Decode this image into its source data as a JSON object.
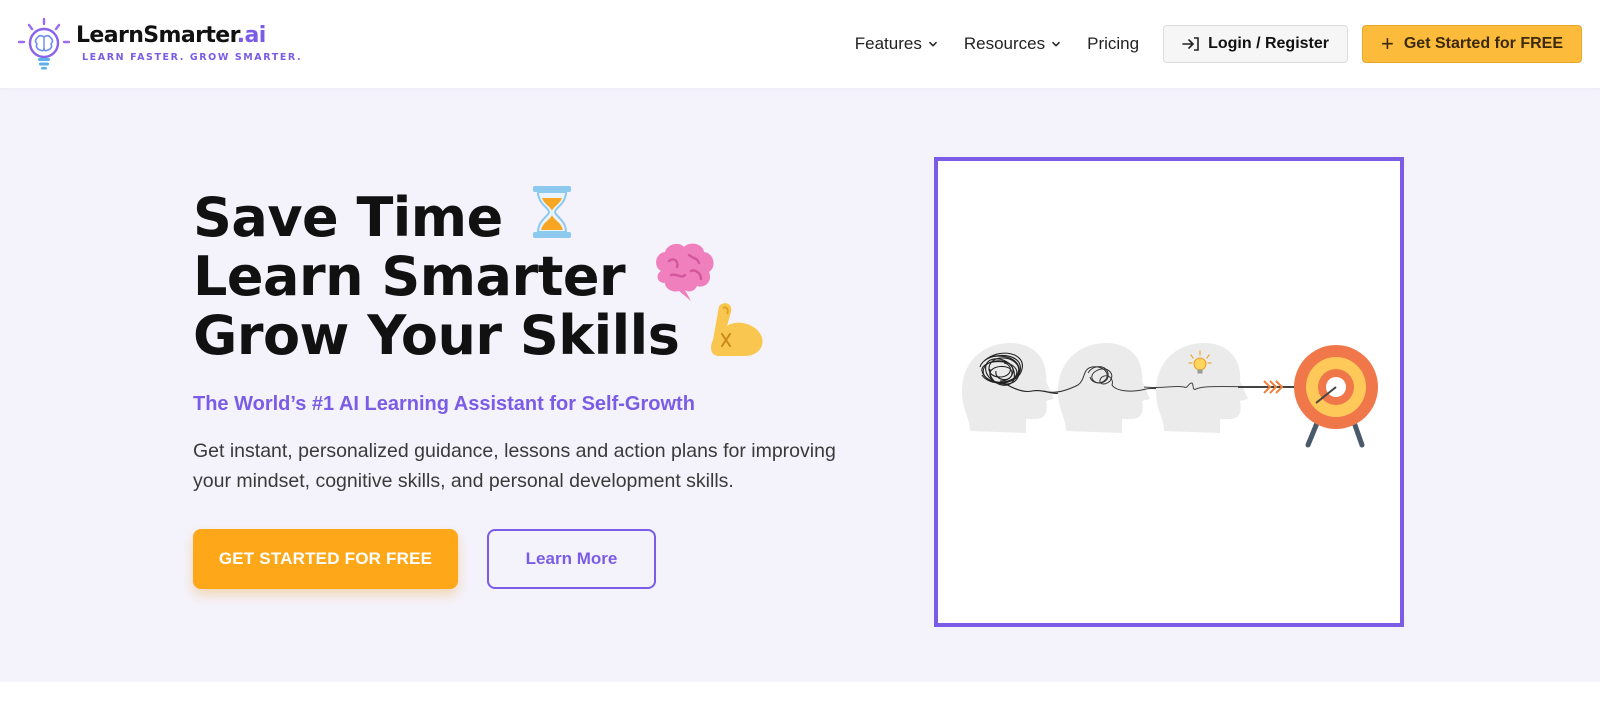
{
  "brand": {
    "name_main": "LearnSmarter",
    "name_suffix": ".ai",
    "tagline": "LEARN FASTER. GROW SMARTER.",
    "icon": "brain-lightbulb-logo-icon"
  },
  "nav": {
    "items": [
      {
        "label": "Features",
        "has_dropdown": true
      },
      {
        "label": "Resources",
        "has_dropdown": true
      },
      {
        "label": "Pricing",
        "has_dropdown": false
      }
    ],
    "login_label": "Login / Register",
    "login_icon": "login-arrow-icon",
    "cta_label": "Get Started for FREE",
    "cta_icon": "plus-icon"
  },
  "hero": {
    "lines": [
      {
        "text": "Save Time",
        "emoji": "⏳"
      },
      {
        "text": "Learn Smarter",
        "emoji": "🧠"
      },
      {
        "text": "Grow Your Skills",
        "emoji": "💪"
      }
    ],
    "subtitle": "The World’s #1 AI Learning Assistant for Self-Growth",
    "description": "Get instant, personalized guidance, lessons and action plans for improving your mindset, cognitive skills, and personal development skills.",
    "primary_cta": "GET STARTED FOR FREE",
    "secondary_cta": "Learn More",
    "illustration": "heads-to-target-illustration"
  },
  "colors": {
    "accent": "#7b5ce6",
    "cta": "#fea719",
    "hero_bg": "#f4f3fc"
  }
}
